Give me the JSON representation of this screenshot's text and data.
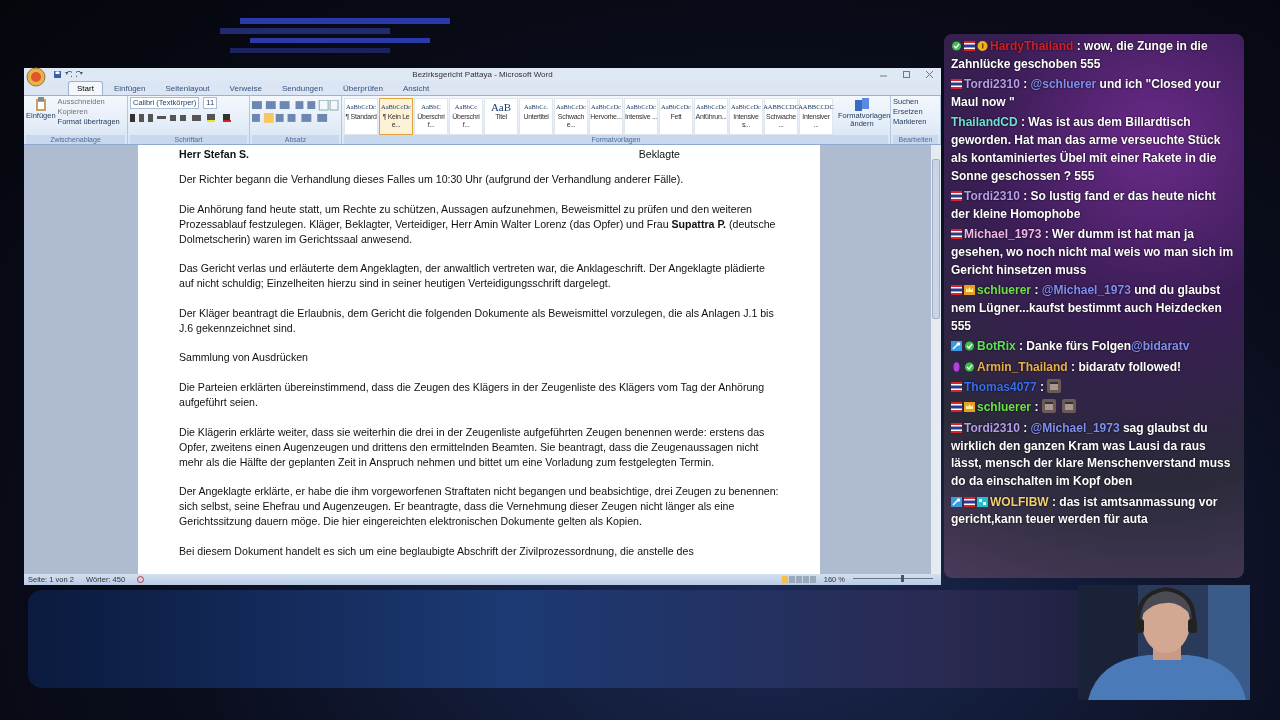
{
  "word": {
    "title": "Bezirksgericht Pattaya - Microsoft Word",
    "tabs": [
      {
        "label": "Start",
        "selected": true
      },
      {
        "label": "Einfügen",
        "selected": false
      },
      {
        "label": "Seitenlayout",
        "selected": false
      },
      {
        "label": "Verweise",
        "selected": false
      },
      {
        "label": "Sendungen",
        "selected": false
      },
      {
        "label": "Überprüfen",
        "selected": false
      },
      {
        "label": "Ansicht",
        "selected": false
      }
    ],
    "clipboard": {
      "paste": "Einfügen",
      "cut": "Ausschneiden",
      "copy": "Kopieren",
      "format": "Format übertragen",
      "label": "Zwischenablage"
    },
    "font": {
      "name": "Calibri (Textkörper)",
      "size": "11",
      "label": "Schriftart"
    },
    "paragraph": {
      "label": "Absatz"
    },
    "styles": [
      {
        "preview": "AaBbCcDc",
        "label": "¶ Standard",
        "selected": false
      },
      {
        "preview": "AaBbCcDc",
        "label": "¶ Kein Lee...",
        "selected": true
      },
      {
        "preview": "AaBbC",
        "label": "Überschrif...",
        "selected": false
      },
      {
        "preview": "AaBbCc",
        "label": "Überschrif...",
        "selected": false
      },
      {
        "preview": "AaB",
        "label": "Titel",
        "selected": false
      },
      {
        "preview": "AaBbCc.",
        "label": "Untertitel",
        "selected": false
      },
      {
        "preview": "AaBbCcDc",
        "label": "Schwache...",
        "selected": false
      },
      {
        "preview": "AaBbCcDc",
        "label": "Hervorhe...",
        "selected": false
      },
      {
        "preview": "AaBbCcDc",
        "label": "Intensive ...",
        "selected": false
      },
      {
        "preview": "AaBbCcDc",
        "label": "Fett",
        "selected": false
      },
      {
        "preview": "AaBbCcDc",
        "label": "Anführun...",
        "selected": false
      },
      {
        "preview": "AaBbCcDc",
        "label": "Intensives...",
        "selected": false
      },
      {
        "preview": "AABBCCDC",
        "label": "Schwache ...",
        "selected": false
      },
      {
        "preview": "AABBCCDC",
        "label": "Intensiver ...",
        "selected": false
      }
    ],
    "styles_label": "Formatvorlagen",
    "change_styles": "Formatvorlagen ändern",
    "editing": {
      "items": [
        "Suchen",
        "Ersetzen",
        "Markieren"
      ],
      "label": "Bearbeiten"
    },
    "header_left": "Herr Stefan S.",
    "header_right": "Beklagte",
    "paragraphs": [
      "Der Richter begann die Verhandlung dieses Falles um 10:30 Uhr (aufgrund der Verhandlung anderer Fälle).",
      "Die Anhörung fand heute statt, um Rechte zu schützen, Aussagen aufzunehmen, Beweismittel zu prüfen und den weiteren Prozessablauf festzulegen. Kläger, Beklagter, Verteidiger, Herr Amin Walter Lorenz (das Opfer) und Frau **Supattra P.** (deutsche Dolmetscherin) waren im Gerichtssaal anwesend.",
      "Das Gericht verlas und erläuterte dem Angeklagten, der anwaltlich vertreten war, die Anklageschrift. Der Angeklagte plädierte auf nicht schuldig; Einzelheiten hierzu sind in seiner heutigen Verteidigungsschrift dargelegt.",
      "Der Kläger beantragt die Erlaubnis, dem Gericht die folgenden Dokumente als Beweismittel vorzulegen, die als Anlagen J.1 bis J.6 gekennzeichnet sind.",
      "Sammlung von Ausdrücken",
      "Die Parteien erklärten übereinstimmend, dass die Zeugen des Klägers in der Zeugenliste des Klägers vom Tag der Anhörung aufgeführt seien.",
      "Die Klägerin erklärte weiter, dass sie weiterhin die drei in der Zeugenliste aufgeführten Zeugen benennen werde: erstens das Opfer, zweitens einen Augenzeugen und drittens den ermittelnden Beamten. Sie beantragt, dass die Zeugenaussagen nicht mehr als die Hälfte der geplanten Zeit in Anspruch nehmen und bittet um eine Vorladung zum festgelegten Termin.",
      "Der Angeklagte erklärte, er habe die ihm vorgeworfenen Straftaten nicht begangen und beabsichtige, drei Zeugen zu benennen: sich selbst, seine Ehefrau und Augenzeugen. Er beantragte, dass die Vernehmung dieser Zeugen nicht länger als eine Gerichtssitzung dauern möge. Die hier eingereichten elektronischen Dokumente gelten als Kopien.",
      "Bei diesem Dokument handelt es sich um eine beglaubigte Abschrift der Zivilprozessordnung, die anstelle des"
    ],
    "status": {
      "page": "Seite: 1 von 2",
      "words": "Wörter: 450",
      "zoom": "160 %",
      "zoom_slider": {
        "level": 0.62
      }
    }
  },
  "chat": [
    {
      "badges": [
        {
          "kind": "verified"
        },
        {
          "kind": "flag"
        },
        {
          "kind": "sub"
        }
      ],
      "user": "HardyThailand",
      "separator": ":",
      "color": "#d0202a",
      "parts": [
        {
          "kind": "text",
          "text": "wow, die Zunge in die Zahnlücke geschoben 555"
        }
      ]
    },
    {
      "badges": [
        {
          "kind": "flag"
        }
      ],
      "user": "Tordi2310",
      "separator": ":",
      "color": "#b79be8",
      "parts": [
        {
          "kind": "mention",
          "text": "@schluerer"
        },
        {
          "kind": "text",
          "text": "und ich \"Closed your Maul now \""
        }
      ]
    },
    {
      "user": "ThailandCD",
      "separator": ":",
      "color": "#6fe0d2",
      "parts": [
        {
          "kind": "text",
          "text": "Was ist aus dem Billardtisch geworden. Hat man das arme verseuchte Stück als kontaminiertes Übel mit einer Rakete in die Sonne geschossen ? 555"
        }
      ]
    },
    {
      "badges": [
        {
          "kind": "flag"
        }
      ],
      "user": "Tordi2310",
      "separator": ":",
      "color": "#b79be8",
      "parts": [
        {
          "kind": "text",
          "text": "So lustig fand er das heute nicht der kleine Homophobe"
        }
      ]
    },
    {
      "badges": [
        {
          "kind": "flag"
        }
      ],
      "user": "Michael_1973",
      "separator": ":",
      "color": "#f0b8e8",
      "parts": [
        {
          "kind": "text",
          "text": "Wer dumm ist hat man ja gesehen, wo noch nicht mal weis wo man sich im Gericht hinsetzen muss"
        }
      ]
    },
    {
      "badges": [
        {
          "kind": "flag"
        },
        {
          "kind": "crown"
        }
      ],
      "user": "schluerer",
      "separator": ":",
      "color": "#6fe04a",
      "parts": [
        {
          "kind": "mention",
          "text": "@Michael_1973"
        },
        {
          "kind": "text",
          "text": "und du glaubst nem Lügner...kaufst bestimmt auch Heizdecken 555"
        }
      ]
    },
    {
      "badges": [
        {
          "kind": "tool"
        },
        {
          "kind": "verified"
        }
      ],
      "user": "BotRix",
      "separator": ":",
      "color": "#5fe05a",
      "parts": [
        {
          "kind": "text",
          "text": "Danke fürs Folgen"
        },
        {
          "kind": "mention",
          "text": "@bidaratv"
        }
      ]
    },
    {
      "badges": [
        {
          "kind": "drop"
        },
        {
          "kind": "verified"
        }
      ],
      "user": "Armin_Thailand",
      "separator": ":",
      "color": "#e8b04a",
      "parts": [
        {
          "kind": "text",
          "text": "bidaratv followed!"
        }
      ]
    },
    {
      "badges": [
        {
          "kind": "flag"
        }
      ],
      "user": "Thomas4077",
      "separator": ":",
      "color": "#3a6ee8",
      "parts": [
        {
          "kind": "emote"
        }
      ]
    },
    {
      "badges": [
        {
          "kind": "flag"
        },
        {
          "kind": "crown"
        }
      ],
      "user": "schluerer",
      "separator": ":",
      "color": "#6fe04a",
      "parts": [
        {
          "kind": "emote"
        },
        {
          "kind": "emote"
        }
      ]
    },
    {
      "badges": [
        {
          "kind": "flag"
        }
      ],
      "user": "Tordi2310",
      "separator": ":",
      "color": "#b79be8",
      "parts": [
        {
          "kind": "mention",
          "text": "@Michael_1973"
        },
        {
          "kind": "text",
          "text": "sag glaubst du wirklich den ganzen Kram was Lausi da raus lässt, mensch der klare Menschenverstand muss do da einschalten im Kopf oben"
        }
      ]
    },
    {
      "badges": [
        {
          "kind": "tool"
        },
        {
          "kind": "flag"
        },
        {
          "kind": "artist"
        }
      ],
      "user": "WOLFIBW",
      "separator": ":",
      "color": "#f0d070",
      "parts": [
        {
          "kind": "text",
          "text": "das ist amtsanmassung vor gericht,kann teuer werden für auta"
        }
      ]
    }
  ]
}
